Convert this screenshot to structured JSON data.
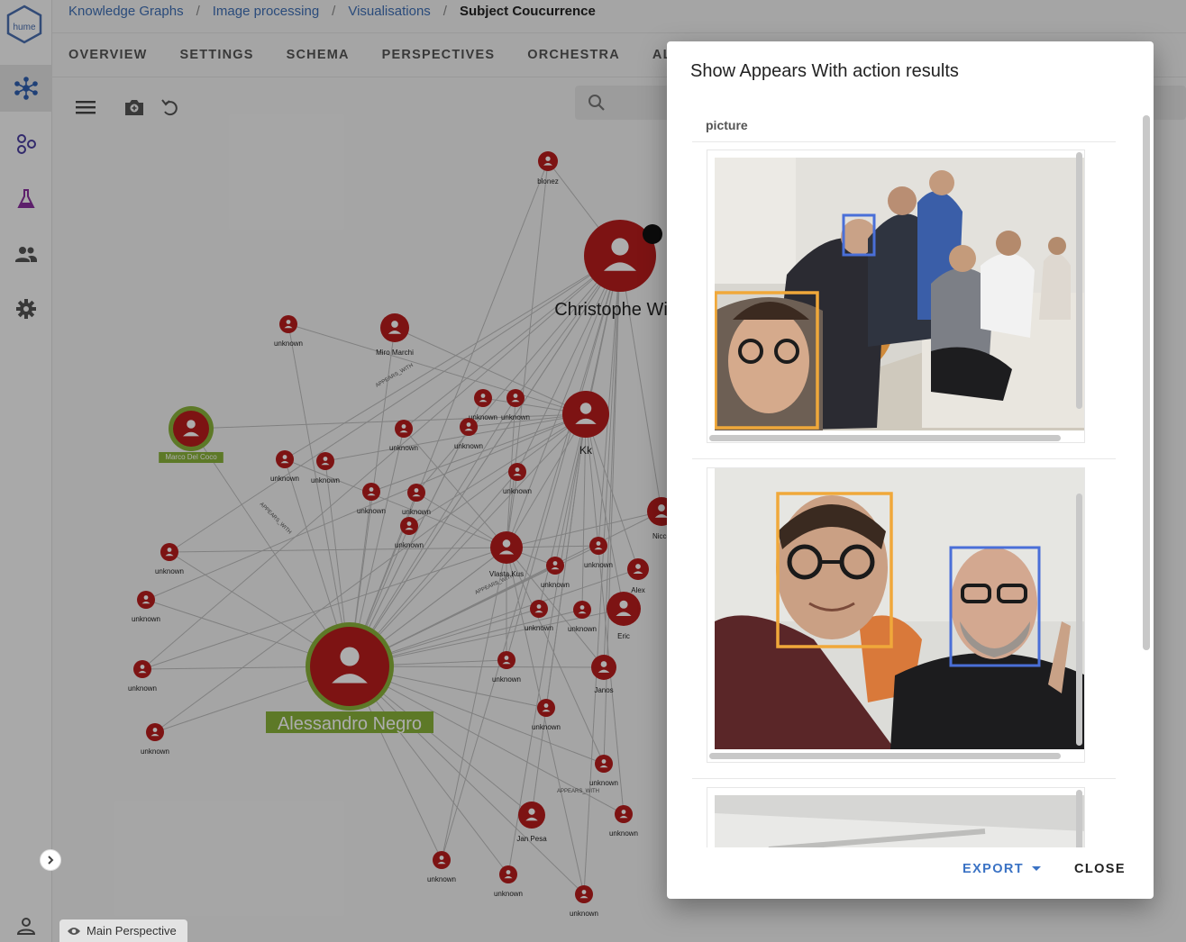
{
  "breadcrumb": [
    "Knowledge Graphs",
    "Image processing",
    "Visualisations",
    "Subject Coucurrence"
  ],
  "tabs": [
    "OVERVIEW",
    "SETTINGS",
    "SCHEMA",
    "PERSPECTIVES",
    "ORCHESTRA",
    "ALE"
  ],
  "perspective_label": "Main Perspective",
  "logo_text": "hume",
  "graph": {
    "edge_label": "APPEARS_WITH",
    "nodes": [
      {
        "label": "Christophe Wille",
        "size": "xl"
      },
      {
        "label": "Alessandro Negro",
        "size": "xl",
        "highlighted": true
      },
      {
        "label": "Marco Del Coco",
        "highlighted": true
      },
      {
        "label": "Kk"
      },
      {
        "label": "Miro Marchi"
      },
      {
        "label": "Vlasta Kus"
      },
      {
        "label": "Eric"
      },
      {
        "label": "Janos"
      },
      {
        "label": "Jan Pesa"
      },
      {
        "label": "Nicco"
      },
      {
        "label": "Alex"
      },
      {
        "label": "unknown"
      },
      {
        "label": "blonez"
      }
    ]
  },
  "dialog": {
    "title": "Show Appears With action results",
    "column_header": "picture",
    "export_label": "EXPORT",
    "close_label": "CLOSE",
    "box_colors": {
      "primary": "#f0a83a",
      "secondary": "#4a6fd8"
    }
  },
  "colors": {
    "node_red": "#b81c1c",
    "highlight_green": "#8ab33a",
    "link_blue": "#3f6fb5",
    "accent_blue": "#3a72c4"
  }
}
